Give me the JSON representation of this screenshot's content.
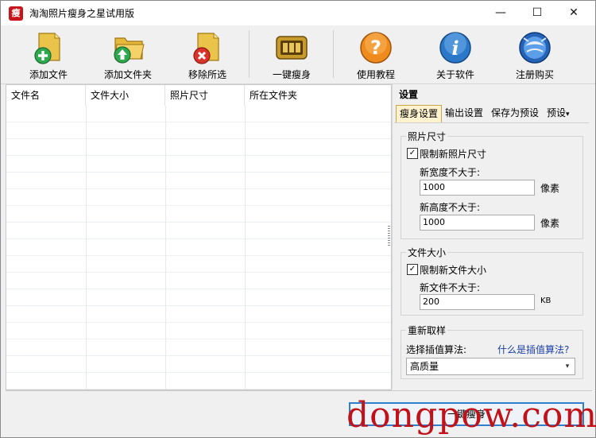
{
  "window": {
    "title": "淘淘照片瘦身之星试用版",
    "app_icon_glyph": "瘦",
    "controls": {
      "minimize": "—",
      "maximize": "☐",
      "close": "✕"
    }
  },
  "toolbar": {
    "buttons": [
      {
        "label": "添加文件",
        "icon": "add-file-icon"
      },
      {
        "label": "添加文件夹",
        "icon": "add-folder-icon"
      },
      {
        "label": "移除所选",
        "icon": "remove-selected-icon"
      },
      {
        "label": "一键瘦身",
        "icon": "one-click-slim-icon"
      },
      {
        "label": "使用教程",
        "icon": "help-tutorial-icon"
      },
      {
        "label": "关于软件",
        "icon": "about-info-icon"
      },
      {
        "label": "注册购买",
        "icon": "register-buy-icon"
      }
    ]
  },
  "file_list": {
    "columns": [
      "文件名",
      "文件大小",
      "照片尺寸",
      "所在文件夹"
    ]
  },
  "settings": {
    "title": "设置",
    "tabs": [
      "瘦身设置",
      "输出设置",
      "保存为预设",
      "预设"
    ],
    "dropdown_arrow": "▾",
    "photo_size": {
      "group_title": "照片尺寸",
      "limit_label": "限制新照片尺寸",
      "limit_checked": true,
      "width_label": "新宽度不大于:",
      "width_value": "1000",
      "width_unit": "像素",
      "height_label": "新高度不大于:",
      "height_value": "1000",
      "height_unit": "像素"
    },
    "file_size": {
      "group_title": "文件大小",
      "limit_label": "限制新文件大小",
      "limit_checked": true,
      "max_label": "新文件不大于:",
      "max_value": "200",
      "max_unit": "KB"
    },
    "resample": {
      "group_title": "重新取样",
      "algo_label": "选择插值算法:",
      "help_link": "什么是插值算法?",
      "algo_value": "高质量"
    }
  },
  "bottom": {
    "run_button": "一键瘦身"
  },
  "watermark": "dongpow.com",
  "colors": {
    "accent": "#2f7fcc",
    "link": "#1c3fa5",
    "watermark": "#c1121a",
    "active_tab_bg": "#fff3cf"
  }
}
